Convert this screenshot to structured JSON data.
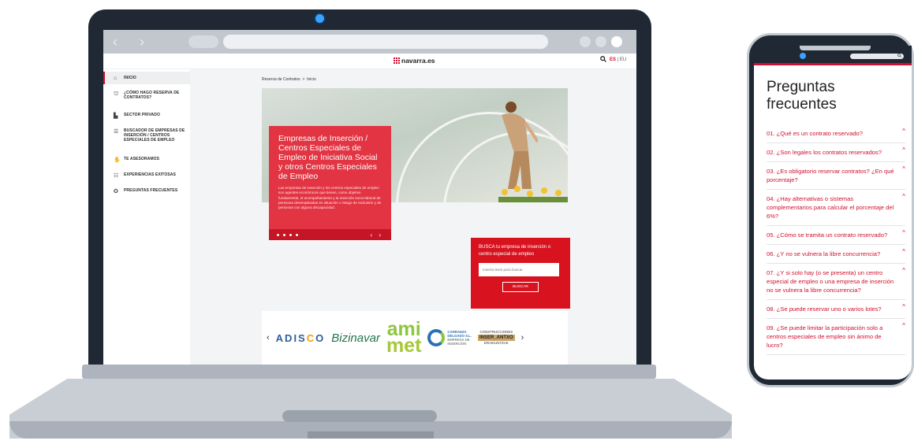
{
  "laptop": {
    "browser": {
      "back_icon": "chevron-left-icon",
      "forward_icon": "chevron-right-icon"
    },
    "site": {
      "logo": "navarra.es",
      "search_icon": "search-icon",
      "lang_es": "ES",
      "lang_sep": "|",
      "lang_eu": "EU"
    },
    "sidebar": {
      "items": [
        {
          "label": "INICIO",
          "icon": "home-icon",
          "glyph": "⌂",
          "active": true
        },
        {
          "label": "¿CÓMO HAGO RESERVA DE CONTRATOS?",
          "icon": "institution-icon",
          "glyph": "⛫",
          "active": false
        },
        {
          "label": "SECTOR PRIVADO",
          "icon": "buildings-icon",
          "glyph": "▙",
          "active": false
        },
        {
          "label": "BUSCADOR DE EMPRESAS DE INSERCIÓN / CENTROS ESPECIALES DE EMPLEO",
          "icon": "list-icon",
          "glyph": "☰",
          "active": false
        },
        {
          "label": "TE ASESORAMOS",
          "icon": "handshake-icon",
          "glyph": "✋",
          "active": false
        },
        {
          "label": "EXPERIENCIAS EXITOSAS",
          "icon": "people-icon",
          "glyph": "☷",
          "active": false
        },
        {
          "label": "PREGUNTAS FRECUENTES",
          "icon": "help-icon",
          "glyph": "✪",
          "active": false
        }
      ]
    },
    "breadcrumb": {
      "part1": "Reserva de Contratos",
      "sep": ">",
      "part2": "Inicio"
    },
    "hero": {
      "title": "Empresas de Inserción / Centros Especiales de Empleo de Iniciativa Social y otros Centros Especiales de Empleo",
      "text": "Las empresas de inserción y los centros especiales de empleo son agentes económicos que tienen, como objetivo fundamental, el acompañamiento y la inserción socio-laboral de personas desempleadas en situación o riesgo de exclusión y de personas con alguna discapacidad.",
      "arrows": "‹ ›"
    },
    "busca": {
      "title": "BUSCA tu empresa de inserción o centro especial de empleo",
      "placeholder": "Inserta texto para buscar",
      "button": "BUSCAR"
    },
    "logos": {
      "prev": "‹",
      "next": "›",
      "adisco_a": "ADIS",
      "adisco_b": "C",
      "adisco_c": "O",
      "bizinavar": "Bizinavar",
      "amimet_1": "ami",
      "amimet_2": "met",
      "carranza_1": "CARRANZA",
      "carranza_2": "DELGADO S.L.",
      "carranza_3": "EMPRESA DE",
      "carranza_4": "INSERCIÓN",
      "inser_1": "CONSTRUCCIONES",
      "inser_2": "INSER_ANTXO",
      "inser_3": "ERAIKUNTZAK"
    }
  },
  "phone": {
    "search_icon": "search-icon",
    "title": "Preguntas frecuentes",
    "questions": [
      "01. ¿Qué es un contrato reservado?",
      "02. ¿Son legales los contratos reservados?",
      "03. ¿Es obligatorio reservar contratos? ¿En qué porcentaje?",
      "04. ¿Hay alternativas o sistemas complementarios para calcular el porcentaje del 6%?",
      "05. ¿Cómo se tramita un contrato reservado?",
      "06. ¿Y no se vulnera la libre concurrencia?",
      "07. ¿Y si solo hay (o se presenta) un centro especial de empleo o una empresa de inserción no se vulnera la libre concurrencia?",
      "08. ¿Se puede reservar uno o varios lotes?",
      "09. ¿Se puede limitar la participación solo a centros especiales de empleo sin ánimo de lucro?"
    ],
    "caret": "^"
  },
  "colors": {
    "brand_red": "#d0102e",
    "hero_red": "#e23442",
    "device_dark": "#1f2833",
    "camera_blue": "#3da1ff"
  }
}
